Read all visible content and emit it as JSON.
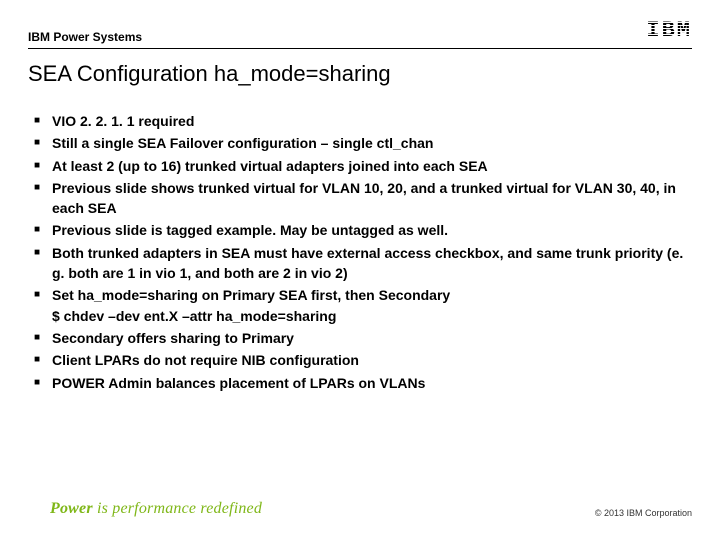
{
  "header": {
    "label": "IBM Power Systems",
    "logo_text": "IBM"
  },
  "title": "SEA Configuration ha_mode=sharing",
  "bullets": [
    {
      "text": "VIO 2. 2. 1. 1 required"
    },
    {
      "text": "Still a single SEA Failover configuration – single ctl_chan"
    },
    {
      "text": "At least 2 (up to 16) trunked virtual adapters joined into each SEA"
    },
    {
      "text": "Previous slide shows trunked virtual for VLAN 10, 20, and a trunked virtual for VLAN 30, 40, in each SEA"
    },
    {
      "text": "Previous slide is tagged example.  May be untagged as well."
    },
    {
      "text": "Both trunked adapters in SEA must have external access checkbox, and same trunk priority (e. g. both are 1 in vio 1, and both are 2 in vio 2)"
    },
    {
      "text": "Set ha_mode=sharing on Primary SEA first, then Secondary",
      "sub": "$ chdev –dev ent.X –attr ha_mode=sharing"
    },
    {
      "text": "Secondary offers sharing to Primary"
    },
    {
      "text": "Client LPARs do not require NIB configuration"
    },
    {
      "text": "POWER Admin balances placement of LPARs on VLANs"
    }
  ],
  "tagline": {
    "prefix": "Power",
    "rest": " is performance redefined"
  },
  "copyright": "© 2013 IBM Corporation"
}
